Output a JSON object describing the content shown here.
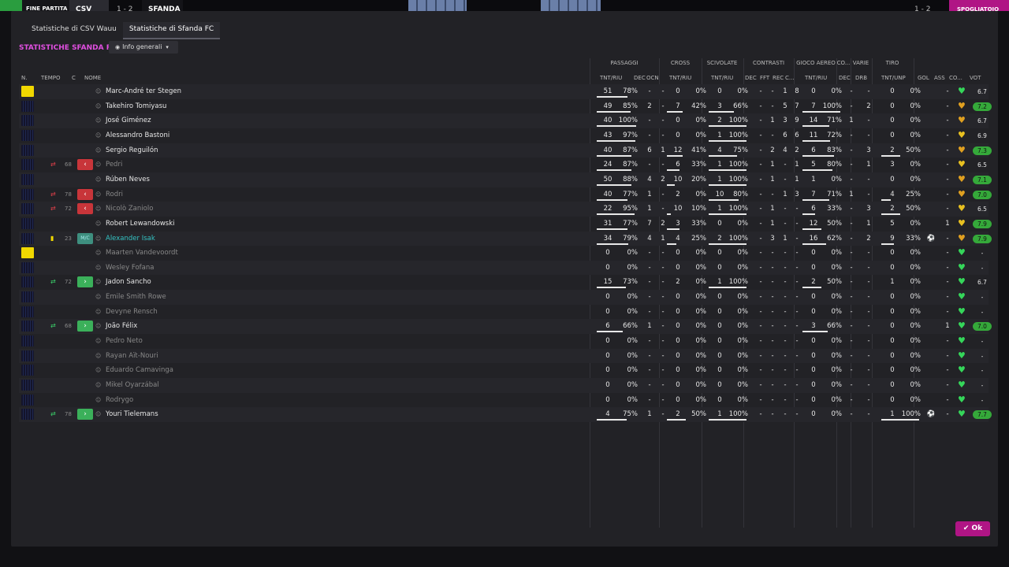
{
  "topbar": {
    "status": "FINE PARTITA",
    "home": "CSV WAU",
    "away": "SFANDA",
    "score": "1 - 2",
    "right_score": "1 - 2",
    "right_label": "SPOGLIATOIO"
  },
  "tabs": [
    "Statistiche di CSV Wauu",
    "Statistiche di Sfanda FC"
  ],
  "section_title": "STATISTICHE SFANDA FC",
  "dropdown_label": "Info generali",
  "groups": {
    "passaggi": "PASSAGGI",
    "cross": "CROSS",
    "scivolate": "SCIVOLATE",
    "contrasti": "CONTRASTI",
    "aereo": "GIOCO AEREO",
    "co": "CO...",
    "varie": "VARIE",
    "tiro": "TIRO"
  },
  "headers": {
    "n": "N.",
    "tempo": "TEMPO",
    "c": "C",
    "nome": "NOME",
    "pass": "TNT/RIU",
    "pdec": "DEC",
    "pocn": "OCN",
    "cross": "TNT/RIU",
    "sciv": "TNT/RIU",
    "cdec": "DEC",
    "cfft": "FFT",
    "crec": "REC",
    "cc": "C...",
    "aereo": "TNT/RIU",
    "codec": "DEC",
    "drb": "DRB",
    "tiro": "TNT/UNP",
    "gol": "GOL",
    "ass": "ASS",
    "co": "CO...",
    "vot": "VOT"
  },
  "ok_label": "Ok",
  "players": [
    {
      "kind": "gk",
      "time": "",
      "sub": "",
      "nome": "Marc-André ter Stegen",
      "dim": false,
      "p1": "51",
      "p2": "78%",
      "pb": 0.78,
      "pdec": "-",
      "pocn": "-",
      "c1": "0",
      "c2": "0%",
      "cb": 0,
      "s1": "0",
      "s2": "0%",
      "sb": 0,
      "cdec": "-",
      "cfft": "-",
      "crec": "1",
      "cc": "8",
      "a1": "0",
      "a2": "0%",
      "ab": 0,
      "codec": "-",
      "drb": "-",
      "t1": "0",
      "t2": "0%",
      "tb": 0,
      "gol": "",
      "ass": "-",
      "heart": "#35d65a",
      "vot": "6.7",
      "good": false
    },
    {
      "kind": "pl",
      "time": "",
      "sub": "",
      "nome": "Takehiro Tomiyasu",
      "dim": false,
      "p1": "49",
      "p2": "85%",
      "pb": 0.85,
      "pdec": "2",
      "pocn": "-",
      "c1": "7",
      "c2": "42%",
      "cb": 0.42,
      "s1": "3",
      "s2": "66%",
      "sb": 0.66,
      "cdec": "-",
      "cfft": "-",
      "crec": "5",
      "cc": "7",
      "a1": "7",
      "a2": "100%",
      "ab": 1,
      "codec": "-",
      "drb": "2",
      "t1": "0",
      "t2": "0%",
      "tb": 0,
      "gol": "",
      "ass": "-",
      "heart": "#e0a020",
      "vot": "7.2",
      "good": true
    },
    {
      "kind": "pl",
      "time": "",
      "sub": "",
      "nome": "José Giménez",
      "dim": false,
      "p1": "40",
      "p2": "100%",
      "pb": 1,
      "pdec": "-",
      "pocn": "-",
      "c1": "0",
      "c2": "0%",
      "cb": 0,
      "s1": "2",
      "s2": "100%",
      "sb": 1,
      "cdec": "-",
      "cfft": "1",
      "crec": "3",
      "cc": "9",
      "a1": "14",
      "a2": "71%",
      "ab": 0.71,
      "codec": "1",
      "drb": "-",
      "t1": "0",
      "t2": "0%",
      "tb": 0,
      "gol": "",
      "ass": "-",
      "heart": "#e0a020",
      "vot": "6.7",
      "good": false
    },
    {
      "kind": "pl",
      "time": "",
      "sub": "",
      "nome": "Alessandro Bastoni",
      "dim": false,
      "p1": "43",
      "p2": "97%",
      "pb": 0.97,
      "pdec": "-",
      "pocn": "-",
      "c1": "0",
      "c2": "0%",
      "cb": 0,
      "s1": "1",
      "s2": "100%",
      "sb": 1,
      "cdec": "-",
      "cfft": "-",
      "crec": "6",
      "cc": "6",
      "a1": "11",
      "a2": "72%",
      "ab": 0.72,
      "codec": "-",
      "drb": "-",
      "t1": "0",
      "t2": "0%",
      "tb": 0,
      "gol": "",
      "ass": "-",
      "heart": "#e8c020",
      "vot": "6.9",
      "good": false
    },
    {
      "kind": "pl",
      "time": "",
      "sub": "",
      "nome": "Sergio Reguilón",
      "dim": false,
      "p1": "40",
      "p2": "87%",
      "pb": 0.87,
      "pdec": "6",
      "pocn": "1",
      "c1": "12",
      "c2": "41%",
      "cb": 0.41,
      "s1": "4",
      "s2": "75%",
      "sb": 0.75,
      "cdec": "-",
      "cfft": "2",
      "crec": "4",
      "cc": "2",
      "a1": "6",
      "a2": "83%",
      "ab": 0.83,
      "codec": "-",
      "drb": "3",
      "t1": "2",
      "t2": "50%",
      "tb": 0.5,
      "gol": "",
      "ass": "-",
      "heart": "#e0a020",
      "vot": "7.3",
      "good": true
    },
    {
      "kind": "pl",
      "time": "68",
      "sub": "out",
      "nome": "Pedri",
      "dim": true,
      "p1": "24",
      "p2": "87%",
      "pb": 0.87,
      "pdec": "-",
      "pocn": "-",
      "c1": "6",
      "c2": "33%",
      "cb": 0.33,
      "s1": "1",
      "s2": "100%",
      "sb": 1,
      "cdec": "-",
      "cfft": "1",
      "crec": "-",
      "cc": "1",
      "a1": "5",
      "a2": "80%",
      "ab": 0.8,
      "codec": "-",
      "drb": "1",
      "t1": "3",
      "t2": "0%",
      "tb": 0,
      "gol": "",
      "ass": "-",
      "heart": "#e8c020",
      "vot": "6.5",
      "good": false
    },
    {
      "kind": "pl",
      "time": "",
      "sub": "",
      "nome": "Rúben Neves",
      "dim": false,
      "p1": "50",
      "p2": "88%",
      "pb": 0.88,
      "pdec": "4",
      "pocn": "2",
      "c1": "10",
      "c2": "20%",
      "cb": 0.2,
      "s1": "1",
      "s2": "100%",
      "sb": 1,
      "cdec": "-",
      "cfft": "1",
      "crec": "-",
      "cc": "1",
      "a1": "1",
      "a2": "0%",
      "ab": 0,
      "codec": "-",
      "drb": "-",
      "t1": "0",
      "t2": "0%",
      "tb": 0,
      "gol": "",
      "ass": "-",
      "heart": "#e0a020",
      "vot": "7.1",
      "good": true
    },
    {
      "kind": "pl",
      "time": "78",
      "sub": "out",
      "nome": "Rodri",
      "dim": true,
      "p1": "40",
      "p2": "77%",
      "pb": 0.77,
      "pdec": "1",
      "pocn": "-",
      "c1": "2",
      "c2": "0%",
      "cb": 0,
      "s1": "10",
      "s2": "80%",
      "sb": 0.8,
      "cdec": "-",
      "cfft": "-",
      "crec": "1",
      "cc": "3",
      "a1": "7",
      "a2": "71%",
      "ab": 0.71,
      "codec": "1",
      "drb": "-",
      "t1": "4",
      "t2": "25%",
      "tb": 0.25,
      "gol": "",
      "ass": "-",
      "heart": "#e0a020",
      "vot": "7.0",
      "good": true
    },
    {
      "kind": "pl",
      "time": "72",
      "sub": "out",
      "nome": "Nicolò Zaniolo",
      "dim": true,
      "p1": "22",
      "p2": "95%",
      "pb": 0.95,
      "pdec": "1",
      "pocn": "-",
      "c1": "10",
      "c2": "10%",
      "cb": 0.1,
      "s1": "1",
      "s2": "100%",
      "sb": 1,
      "cdec": "-",
      "cfft": "1",
      "crec": "-",
      "cc": "-",
      "a1": "6",
      "a2": "33%",
      "ab": 0.33,
      "codec": "-",
      "drb": "3",
      "t1": "2",
      "t2": "50%",
      "tb": 0.5,
      "gol": "",
      "ass": "-",
      "heart": "#e8c020",
      "vot": "6.5",
      "good": false
    },
    {
      "kind": "pl",
      "time": "",
      "sub": "",
      "nome": "Robert Lewandowski",
      "dim": false,
      "p1": "31",
      "p2": "77%",
      "pb": 0.77,
      "pdec": "7",
      "pocn": "2",
      "c1": "3",
      "c2": "33%",
      "cb": 0.33,
      "s1": "0",
      "s2": "0%",
      "sb": 0,
      "cdec": "-",
      "cfft": "1",
      "crec": "-",
      "cc": "-",
      "a1": "12",
      "a2": "50%",
      "ab": 0.5,
      "codec": "-",
      "drb": "1",
      "t1": "5",
      "t2": "0%",
      "tb": 0,
      "gol": "",
      "ass": "1",
      "heart": "#e8c020",
      "vot": "7.9",
      "good": true
    },
    {
      "kind": "pl",
      "time": "23",
      "sub": "pos",
      "posLabel": "M/C",
      "nome": "Alexander Isak",
      "dim": false,
      "teal": true,
      "p1": "34",
      "p2": "79%",
      "pb": 0.79,
      "pdec": "4",
      "pocn": "1",
      "c1": "4",
      "c2": "25%",
      "cb": 0.25,
      "s1": "2",
      "s2": "100%",
      "sb": 1,
      "cdec": "-",
      "cfft": "3",
      "crec": "1",
      "cc": "-",
      "a1": "16",
      "a2": "62%",
      "ab": 0.62,
      "codec": "-",
      "drb": "2",
      "t1": "9",
      "t2": "33%",
      "tb": 0.33,
      "gol": "⚽",
      "ass": "-",
      "heart": "#e0a020",
      "vot": "7.9",
      "good": true
    },
    {
      "kind": "gk",
      "time": "",
      "sub": "",
      "nome": "Maarten Vandevoordt",
      "dim": true,
      "p1": "0",
      "p2": "0%",
      "pb": 0,
      "pdec": "-",
      "pocn": "-",
      "c1": "0",
      "c2": "0%",
      "cb": 0,
      "s1": "0",
      "s2": "0%",
      "sb": 0,
      "cdec": "-",
      "cfft": "-",
      "crec": "-",
      "cc": "-",
      "a1": "0",
      "a2": "0%",
      "ab": 0,
      "codec": "-",
      "drb": "-",
      "t1": "0",
      "t2": "0%",
      "tb": 0,
      "gol": "",
      "ass": "-",
      "heart": "#35d65a",
      "vot": "-",
      "good": false
    },
    {
      "kind": "pl",
      "time": "",
      "sub": "",
      "nome": "Wesley Fofana",
      "dim": true,
      "p1": "0",
      "p2": "0%",
      "pb": 0,
      "pdec": "-",
      "pocn": "-",
      "c1": "0",
      "c2": "0%",
      "cb": 0,
      "s1": "0",
      "s2": "0%",
      "sb": 0,
      "cdec": "-",
      "cfft": "-",
      "crec": "-",
      "cc": "-",
      "a1": "0",
      "a2": "0%",
      "ab": 0,
      "codec": "-",
      "drb": "-",
      "t1": "0",
      "t2": "0%",
      "tb": 0,
      "gol": "",
      "ass": "-",
      "heart": "#35d65a",
      "vot": "-",
      "good": false
    },
    {
      "kind": "pl",
      "time": "72",
      "sub": "in",
      "nome": "Jadon Sancho",
      "dim": false,
      "p1": "15",
      "p2": "73%",
      "pb": 0.73,
      "pdec": "-",
      "pocn": "-",
      "c1": "2",
      "c2": "0%",
      "cb": 0,
      "s1": "1",
      "s2": "100%",
      "sb": 1,
      "cdec": "-",
      "cfft": "-",
      "crec": "-",
      "cc": "-",
      "a1": "2",
      "a2": "50%",
      "ab": 0.5,
      "codec": "-",
      "drb": "-",
      "t1": "1",
      "t2": "0%",
      "tb": 0,
      "gol": "",
      "ass": "-",
      "heart": "#35d65a",
      "vot": "6.7",
      "good": false
    },
    {
      "kind": "pl",
      "time": "",
      "sub": "",
      "nome": "Emile Smith Rowe",
      "dim": true,
      "p1": "0",
      "p2": "0%",
      "pb": 0,
      "pdec": "-",
      "pocn": "-",
      "c1": "0",
      "c2": "0%",
      "cb": 0,
      "s1": "0",
      "s2": "0%",
      "sb": 0,
      "cdec": "-",
      "cfft": "-",
      "crec": "-",
      "cc": "-",
      "a1": "0",
      "a2": "0%",
      "ab": 0,
      "codec": "-",
      "drb": "-",
      "t1": "0",
      "t2": "0%",
      "tb": 0,
      "gol": "",
      "ass": "-",
      "heart": "#35d65a",
      "vot": "-",
      "good": false
    },
    {
      "kind": "pl",
      "time": "",
      "sub": "",
      "nome": "Devyne Rensch",
      "dim": true,
      "p1": "0",
      "p2": "0%",
      "pb": 0,
      "pdec": "-",
      "pocn": "-",
      "c1": "0",
      "c2": "0%",
      "cb": 0,
      "s1": "0",
      "s2": "0%",
      "sb": 0,
      "cdec": "-",
      "cfft": "-",
      "crec": "-",
      "cc": "-",
      "a1": "0",
      "a2": "0%",
      "ab": 0,
      "codec": "-",
      "drb": "-",
      "t1": "0",
      "t2": "0%",
      "tb": 0,
      "gol": "",
      "ass": "-",
      "heart": "#35d65a",
      "vot": "-",
      "good": false
    },
    {
      "kind": "pl",
      "time": "68",
      "sub": "in",
      "nome": "João Félix",
      "dim": false,
      "p1": "6",
      "p2": "66%",
      "pb": 0.66,
      "pdec": "1",
      "pocn": "-",
      "c1": "0",
      "c2": "0%",
      "cb": 0,
      "s1": "0",
      "s2": "0%",
      "sb": 0,
      "cdec": "-",
      "cfft": "-",
      "crec": "-",
      "cc": "-",
      "a1": "3",
      "a2": "66%",
      "ab": 0.66,
      "codec": "-",
      "drb": "-",
      "t1": "0",
      "t2": "0%",
      "tb": 0,
      "gol": "",
      "ass": "1",
      "heart": "#35d65a",
      "vot": "7.0",
      "good": true
    },
    {
      "kind": "pl",
      "time": "",
      "sub": "",
      "nome": "Pedro Neto",
      "dim": true,
      "p1": "0",
      "p2": "0%",
      "pb": 0,
      "pdec": "-",
      "pocn": "-",
      "c1": "0",
      "c2": "0%",
      "cb": 0,
      "s1": "0",
      "s2": "0%",
      "sb": 0,
      "cdec": "-",
      "cfft": "-",
      "crec": "-",
      "cc": "-",
      "a1": "0",
      "a2": "0%",
      "ab": 0,
      "codec": "-",
      "drb": "-",
      "t1": "0",
      "t2": "0%",
      "tb": 0,
      "gol": "",
      "ass": "-",
      "heart": "#35d65a",
      "vot": "-",
      "good": false
    },
    {
      "kind": "pl",
      "time": "",
      "sub": "",
      "nome": "Rayan Aït-Nouri",
      "dim": true,
      "p1": "0",
      "p2": "0%",
      "pb": 0,
      "pdec": "-",
      "pocn": "-",
      "c1": "0",
      "c2": "0%",
      "cb": 0,
      "s1": "0",
      "s2": "0%",
      "sb": 0,
      "cdec": "-",
      "cfft": "-",
      "crec": "-",
      "cc": "-",
      "a1": "0",
      "a2": "0%",
      "ab": 0,
      "codec": "-",
      "drb": "-",
      "t1": "0",
      "t2": "0%",
      "tb": 0,
      "gol": "",
      "ass": "-",
      "heart": "#35d65a",
      "vot": "-",
      "good": false
    },
    {
      "kind": "pl",
      "time": "",
      "sub": "",
      "nome": "Eduardo Camavinga",
      "dim": true,
      "p1": "0",
      "p2": "0%",
      "pb": 0,
      "pdec": "-",
      "pocn": "-",
      "c1": "0",
      "c2": "0%",
      "cb": 0,
      "s1": "0",
      "s2": "0%",
      "sb": 0,
      "cdec": "-",
      "cfft": "-",
      "crec": "-",
      "cc": "-",
      "a1": "0",
      "a2": "0%",
      "ab": 0,
      "codec": "-",
      "drb": "-",
      "t1": "0",
      "t2": "0%",
      "tb": 0,
      "gol": "",
      "ass": "-",
      "heart": "#35d65a",
      "vot": "-",
      "good": false
    },
    {
      "kind": "pl",
      "time": "",
      "sub": "",
      "nome": "Mikel Oyarzábal",
      "dim": true,
      "p1": "0",
      "p2": "0%",
      "pb": 0,
      "pdec": "-",
      "pocn": "-",
      "c1": "0",
      "c2": "0%",
      "cb": 0,
      "s1": "0",
      "s2": "0%",
      "sb": 0,
      "cdec": "-",
      "cfft": "-",
      "crec": "-",
      "cc": "-",
      "a1": "0",
      "a2": "0%",
      "ab": 0,
      "codec": "-",
      "drb": "-",
      "t1": "0",
      "t2": "0%",
      "tb": 0,
      "gol": "",
      "ass": "-",
      "heart": "#35d65a",
      "vot": "-",
      "good": false
    },
    {
      "kind": "pl",
      "time": "",
      "sub": "",
      "nome": "Rodrygo",
      "dim": true,
      "p1": "0",
      "p2": "0%",
      "pb": 0,
      "pdec": "-",
      "pocn": "-",
      "c1": "0",
      "c2": "0%",
      "cb": 0,
      "s1": "0",
      "s2": "0%",
      "sb": 0,
      "cdec": "-",
      "cfft": "-",
      "crec": "-",
      "cc": "-",
      "a1": "0",
      "a2": "0%",
      "ab": 0,
      "codec": "-",
      "drb": "-",
      "t1": "0",
      "t2": "0%",
      "tb": 0,
      "gol": "",
      "ass": "-",
      "heart": "#35d65a",
      "vot": "-",
      "good": false
    },
    {
      "kind": "pl",
      "time": "78",
      "sub": "in",
      "nome": "Youri Tielemans",
      "dim": false,
      "p1": "4",
      "p2": "75%",
      "pb": 0.75,
      "pdec": "1",
      "pocn": "-",
      "c1": "2",
      "c2": "50%",
      "cb": 0.5,
      "s1": "1",
      "s2": "100%",
      "sb": 1,
      "cdec": "-",
      "cfft": "-",
      "crec": "-",
      "cc": "-",
      "a1": "0",
      "a2": "0%",
      "ab": 0,
      "codec": "-",
      "drb": "-",
      "t1": "1",
      "t2": "100%",
      "tb": 1,
      "gol": "⚽",
      "ass": "-",
      "heart": "#35d65a",
      "vot": "7.7",
      "good": true
    }
  ]
}
